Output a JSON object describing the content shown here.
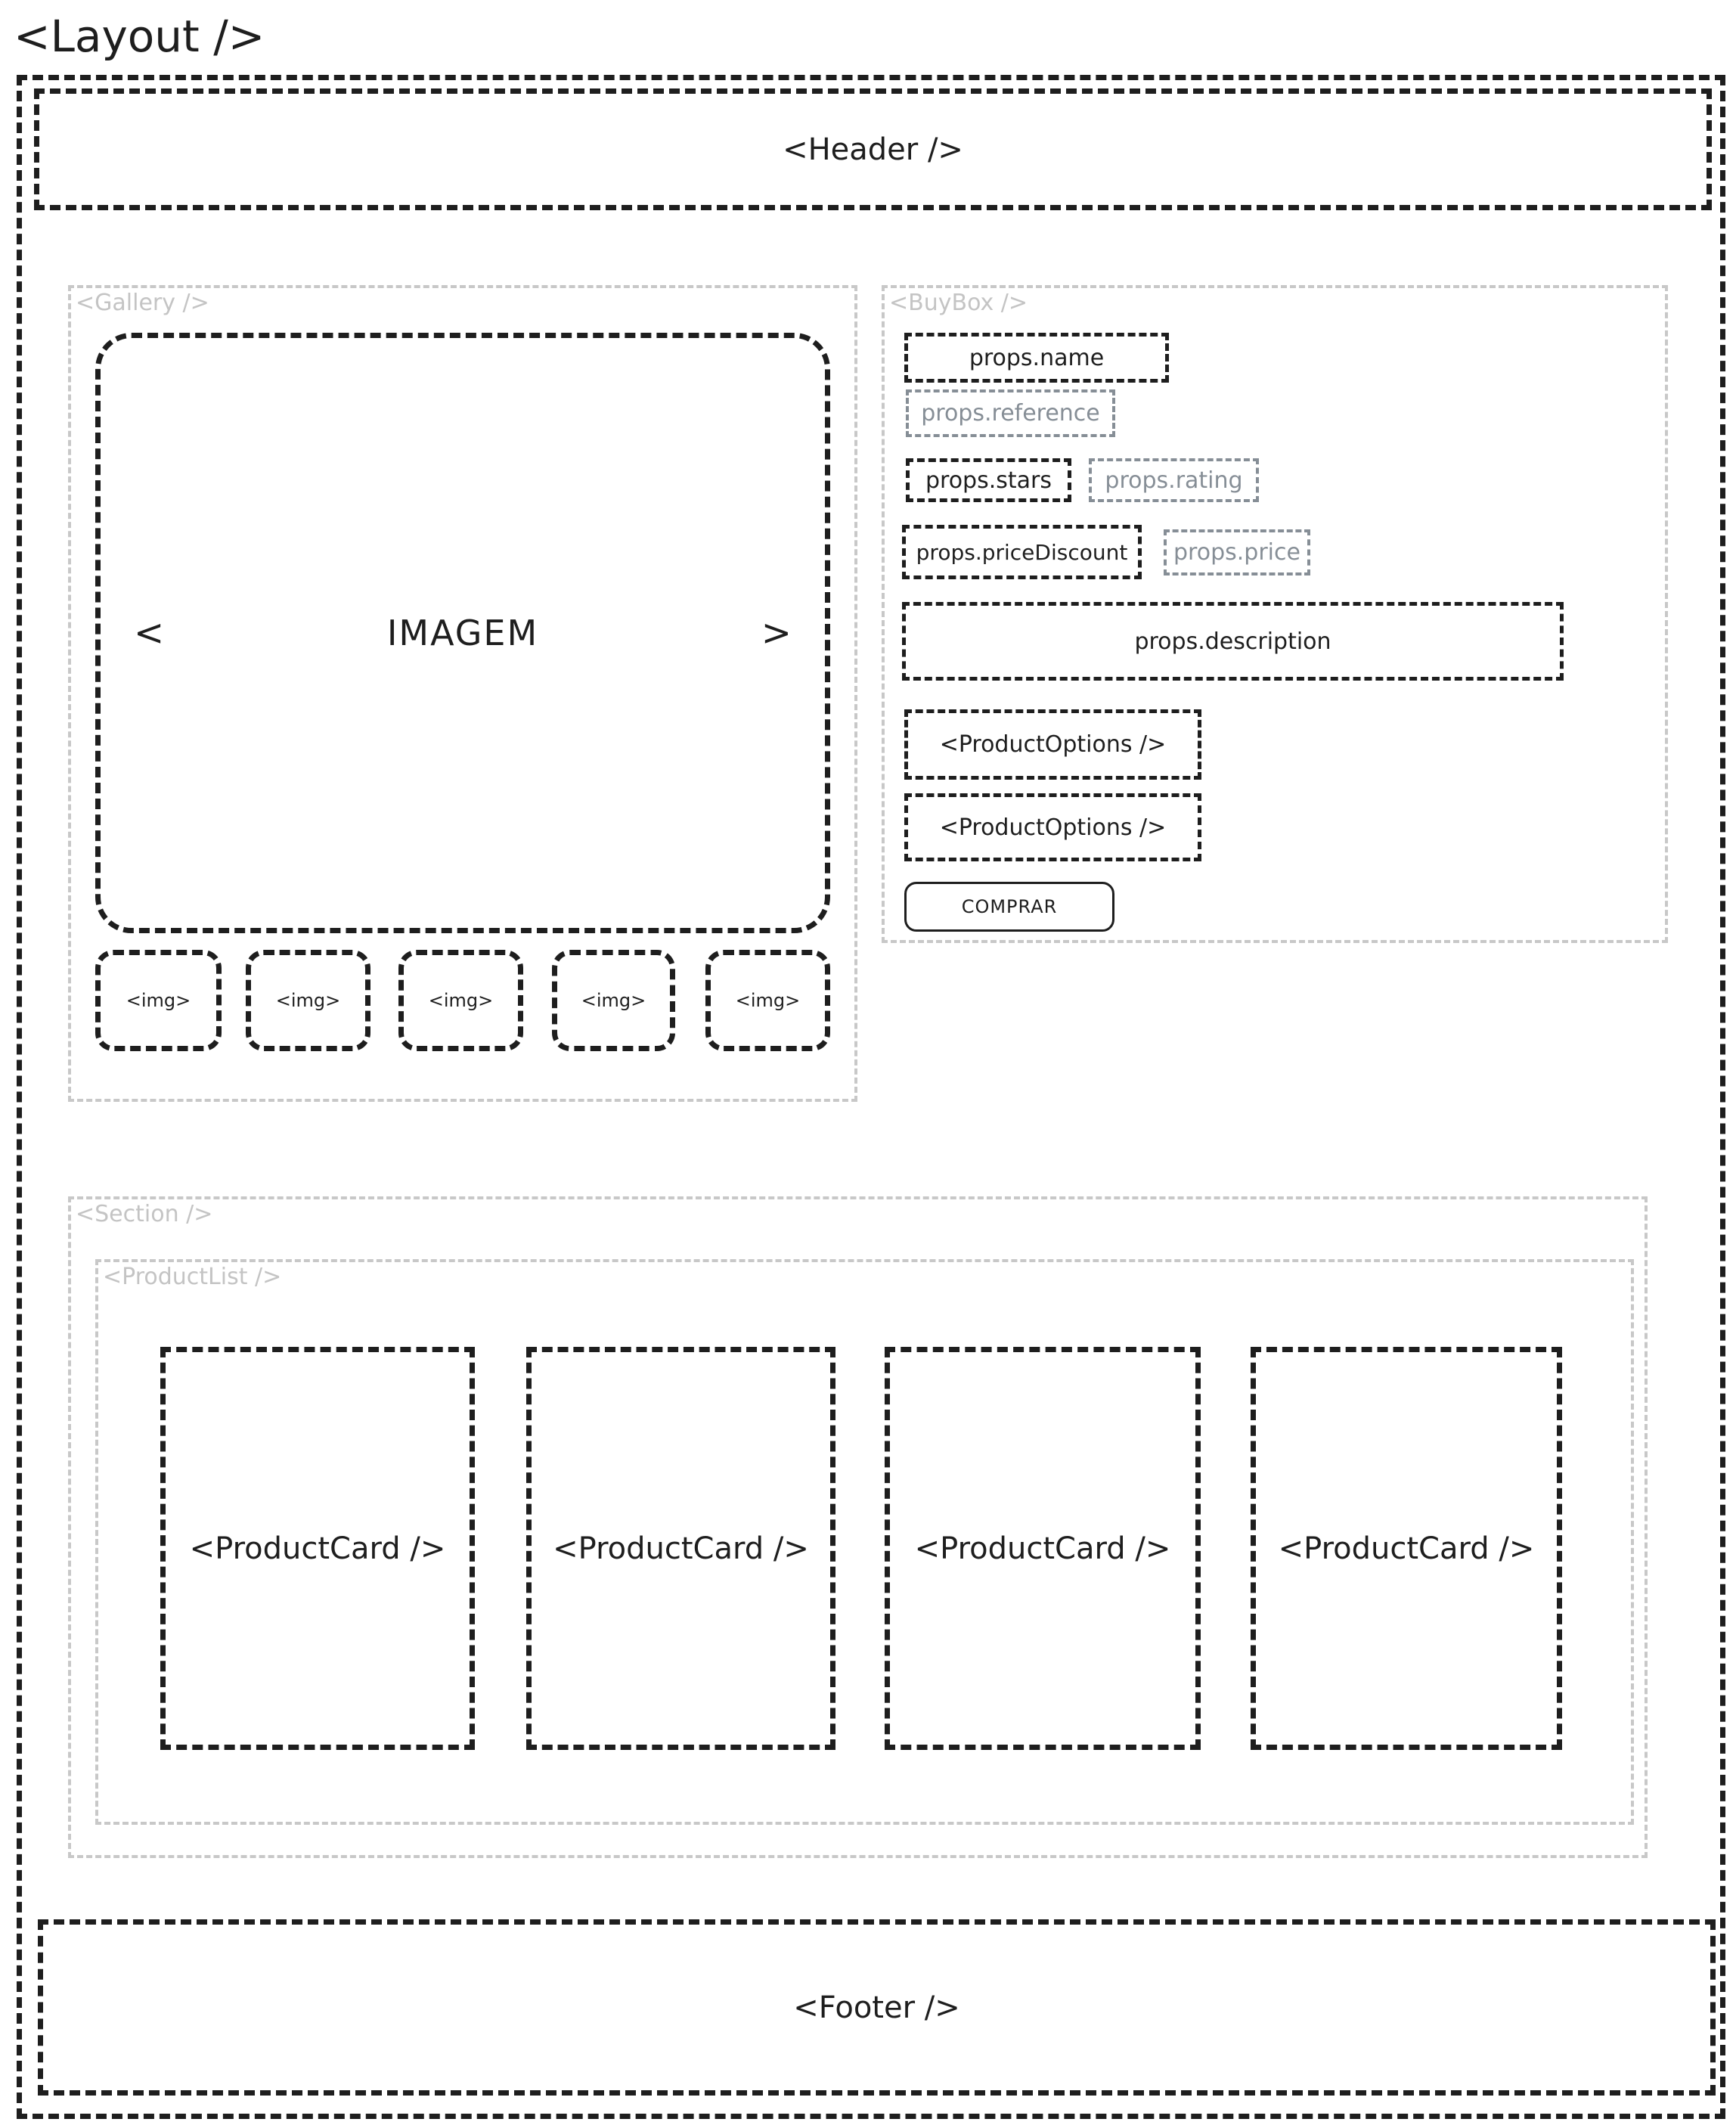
{
  "title": "<Layout />",
  "header": {
    "label": "<Header />"
  },
  "gallery": {
    "label": "<Gallery />",
    "main_image": {
      "label": "IMAGEM",
      "prev_icon": "chevron-left-icon",
      "next_icon": "chevron-right-icon",
      "prev_glyph": "<",
      "next_glyph": ">"
    },
    "thumbnails": [
      "<img>",
      "<img>",
      "<img>",
      "<img>",
      "<img>"
    ]
  },
  "buybox": {
    "label": "<BuyBox />",
    "name": "props.name",
    "reference": "props.reference",
    "stars": "props.stars",
    "rating": "props.rating",
    "price_discount": "props.priceDiscount",
    "price": "props.price",
    "description": "props.description",
    "options": [
      "<ProductOptions />",
      "<ProductOptions />"
    ],
    "buy_button": "COMPRAR"
  },
  "section": {
    "label": "<Section />",
    "product_list": {
      "label": "<ProductList />",
      "cards": [
        "<ProductCard />",
        "<ProductCard />",
        "<ProductCard />",
        "<ProductCard />"
      ]
    }
  },
  "footer": {
    "label": "<Footer />"
  },
  "colors": {
    "ink": "#1e1e1e",
    "secondary": "#868e96",
    "container": "#c8c8c8"
  }
}
